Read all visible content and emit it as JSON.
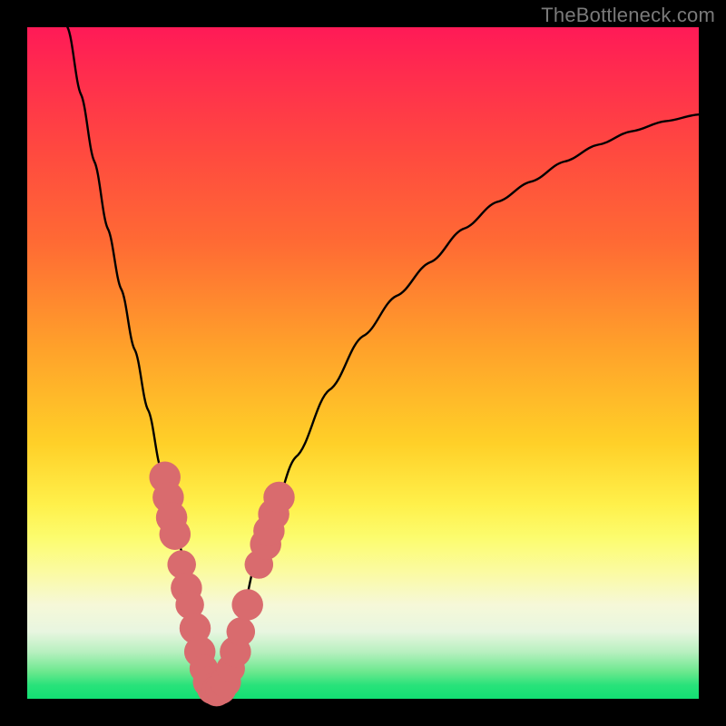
{
  "watermark": "TheBottleneck.com",
  "colors": {
    "background": "#000000",
    "curve": "#000000",
    "marker": "#d96b6e",
    "gradient_top": "#ff1a57",
    "gradient_bottom": "#13e073"
  },
  "chart_data": {
    "type": "line",
    "title": "",
    "xlabel": "",
    "ylabel": "",
    "xlim": [
      0,
      100
    ],
    "ylim": [
      0,
      100
    ],
    "curve": {
      "description": "V-shaped bottleneck curve; minimum near x≈27, y≈0; left branch steep to top-left corner, right branch rises with decreasing slope toward top-right",
      "x": [
        6,
        8,
        10,
        12,
        14,
        16,
        18,
        20,
        21,
        22,
        23,
        24,
        25,
        26,
        27,
        28,
        29,
        30,
        31,
        32,
        34,
        36,
        40,
        45,
        50,
        55,
        60,
        65,
        70,
        75,
        80,
        85,
        90,
        95,
        100
      ],
      "y": [
        100,
        90,
        80,
        70,
        61,
        52,
        43,
        34,
        30,
        26,
        22,
        18,
        13,
        8,
        3,
        1,
        2,
        5,
        9,
        13,
        20,
        26,
        36,
        46,
        54,
        60,
        65,
        70,
        74,
        77,
        80,
        82.5,
        84.5,
        86,
        87
      ]
    },
    "markers": {
      "description": "Salmon-colored dot clusters along lower portion of both branches and across the trough",
      "points": [
        {
          "x": 20.5,
          "y": 33,
          "r": 2.3
        },
        {
          "x": 21.0,
          "y": 30,
          "r": 2.3
        },
        {
          "x": 21.5,
          "y": 27,
          "r": 2.3
        },
        {
          "x": 22.0,
          "y": 24.5,
          "r": 2.3
        },
        {
          "x": 23.0,
          "y": 20,
          "r": 2.1
        },
        {
          "x": 23.7,
          "y": 16.5,
          "r": 2.3
        },
        {
          "x": 24.2,
          "y": 14,
          "r": 2.1
        },
        {
          "x": 25.0,
          "y": 10.5,
          "r": 2.3
        },
        {
          "x": 25.7,
          "y": 7,
          "r": 2.3
        },
        {
          "x": 26.3,
          "y": 4.5,
          "r": 2.1
        },
        {
          "x": 27.0,
          "y": 2.5,
          "r": 2.3
        },
        {
          "x": 27.6,
          "y": 1.5,
          "r": 2.3
        },
        {
          "x": 28.2,
          "y": 1.2,
          "r": 2.3
        },
        {
          "x": 28.8,
          "y": 1.5,
          "r": 2.3
        },
        {
          "x": 29.5,
          "y": 2.5,
          "r": 2.3
        },
        {
          "x": 30.3,
          "y": 4.5,
          "r": 2.1
        },
        {
          "x": 31.0,
          "y": 7,
          "r": 2.3
        },
        {
          "x": 31.8,
          "y": 10,
          "r": 2.1
        },
        {
          "x": 32.8,
          "y": 14,
          "r": 2.3
        },
        {
          "x": 34.5,
          "y": 20,
          "r": 2.1
        },
        {
          "x": 35.5,
          "y": 23,
          "r": 2.3
        },
        {
          "x": 36.0,
          "y": 25,
          "r": 2.3
        },
        {
          "x": 36.7,
          "y": 27.5,
          "r": 2.3
        },
        {
          "x": 37.5,
          "y": 30,
          "r": 2.3
        }
      ]
    }
  }
}
